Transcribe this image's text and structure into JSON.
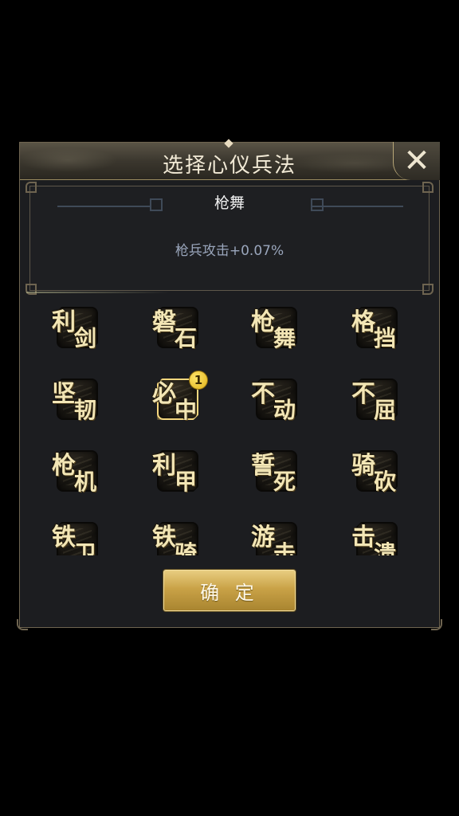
{
  "dialog": {
    "title": "选择心仪兵法",
    "close_icon": "close-x-icon"
  },
  "detail": {
    "name": "枪舞",
    "description": "枪兵攻击+0.07%"
  },
  "skills": [
    {
      "top": "利",
      "bottom": "剑"
    },
    {
      "top": "磐",
      "bottom": "石"
    },
    {
      "top": "枪",
      "bottom": "舞"
    },
    {
      "top": "格",
      "bottom": "挡"
    },
    {
      "top": "坚",
      "bottom": "韧"
    },
    {
      "top": "必",
      "bottom": "中",
      "badge": "1"
    },
    {
      "top": "不",
      "bottom": "动"
    },
    {
      "top": "不",
      "bottom": "屈"
    },
    {
      "top": "枪",
      "bottom": "机"
    },
    {
      "top": "利",
      "bottom": "甲"
    },
    {
      "top": "誓",
      "bottom": "死"
    },
    {
      "top": "骑",
      "bottom": "砍"
    },
    {
      "top": "铁",
      "bottom": "卫"
    },
    {
      "top": "铁",
      "bottom": "骑"
    },
    {
      "top": "游",
      "bottom": "击"
    },
    {
      "top": "击",
      "bottom": "溃"
    }
  ],
  "confirm": {
    "label": "确 定"
  }
}
